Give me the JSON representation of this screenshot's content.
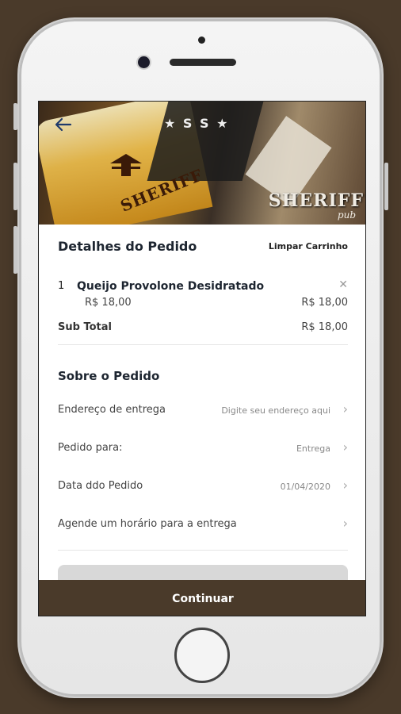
{
  "header": {
    "brand": "SHERIFF",
    "brand_sub": "pub",
    "glass_text": "SHERIFF",
    "stars": "★ S S ★"
  },
  "order": {
    "title": "Detalhes do Pedido",
    "clear_label": "Limpar Carrinho",
    "items": [
      {
        "qty": "1",
        "name": "Queijo Provolone Desidratado",
        "unit_price": "R$ 18,00",
        "total_price": "R$ 18,00"
      }
    ],
    "subtotal_label": "Sub Total",
    "subtotal_value": "R$ 18,00"
  },
  "about": {
    "title": "Sobre o Pedido",
    "rows": [
      {
        "label": "Endereço de entrega",
        "value": "Digite seu endereço aqui"
      },
      {
        "label": "Pedido para:",
        "value": "Entrega"
      },
      {
        "label": "Data ddo Pedido",
        "value": "01/04/2020"
      },
      {
        "label": "Agende um horário para a entrega",
        "value": ""
      }
    ]
  },
  "footer": {
    "continue_label": "Continuar"
  },
  "colors": {
    "primary": "#4a3a2a",
    "text": "#1d2530"
  },
  "icons": {
    "back": "arrow-left-icon",
    "remove": "close-icon",
    "chevron": "chevron-right-icon"
  }
}
